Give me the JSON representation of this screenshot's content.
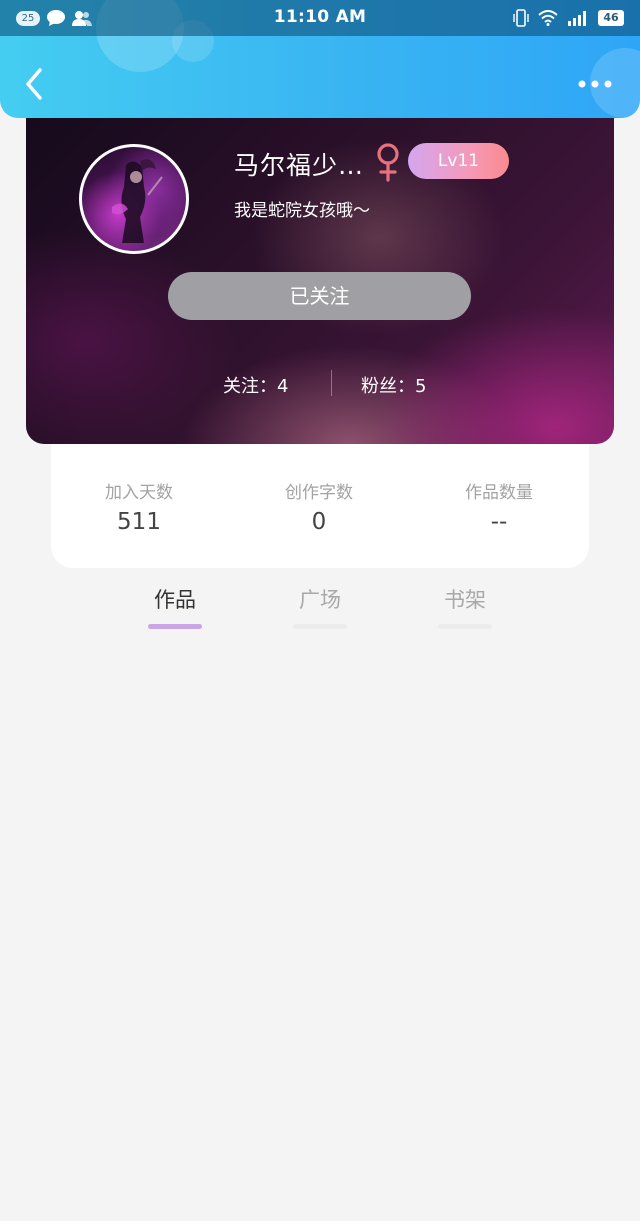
{
  "status_bar": {
    "notification_count": "25",
    "time": "11:10 AM",
    "battery": "46",
    "icons": [
      "notification-count-badge",
      "chat-bubble-icon",
      "contacts-icon",
      "vibrate-icon",
      "wifi-icon",
      "signal-icon",
      "battery-icon"
    ]
  },
  "nav": {
    "back_icon": "chevron-left-icon",
    "more_icon": "more-dots-icon"
  },
  "profile": {
    "username": "马尔福少…",
    "gender": "female",
    "gender_color": "#e8707f",
    "level": "Lv11",
    "bio": "我是蛇院女孩哦～",
    "follow_button": "已关注",
    "following_text": "关注：4",
    "fans_text": "粉丝：5"
  },
  "stats": [
    {
      "label": "加入天数",
      "value": "511"
    },
    {
      "label": "创作字数",
      "value": "0"
    },
    {
      "label": "作品数量",
      "value": "--"
    }
  ],
  "tabs": [
    {
      "label": "作品",
      "active": true
    },
    {
      "label": "广场",
      "active": false
    },
    {
      "label": "书架",
      "active": false
    }
  ],
  "colors": {
    "header_gradient_start": "#44cdf1",
    "header_gradient_end": "#2ea6f7",
    "level_badge_start": "#d4a6f0",
    "level_badge_end": "#fb8a8f",
    "follow_button_bg": "#a09fa3",
    "active_tab_indicator": "#c9a5e6",
    "page_bg": "#f4f4f4"
  }
}
